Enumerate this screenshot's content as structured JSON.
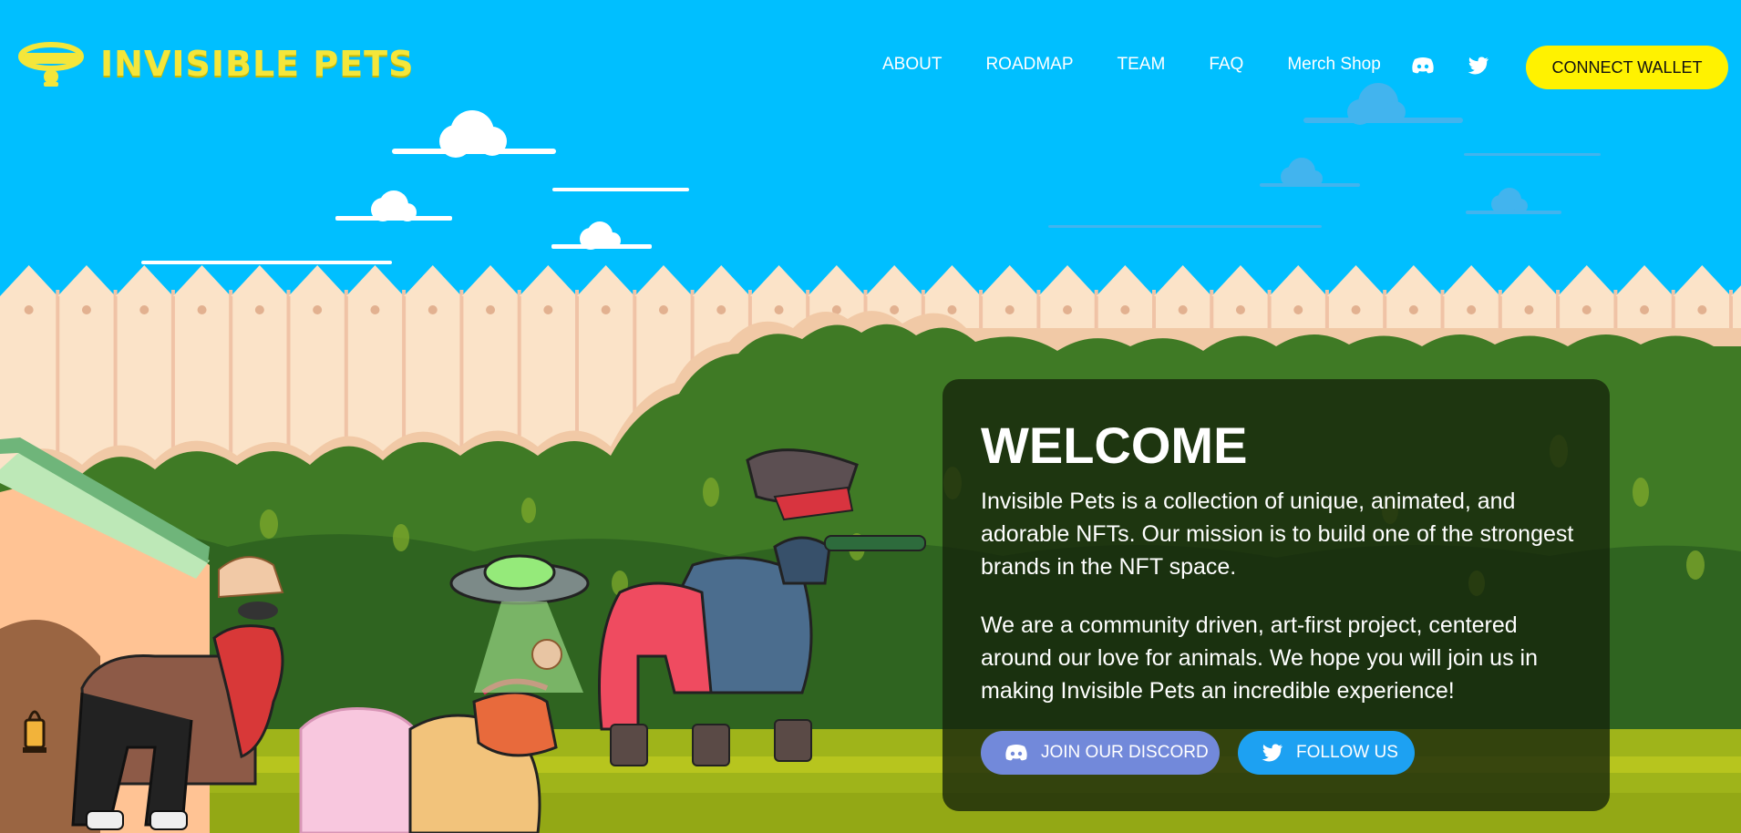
{
  "header": {
    "logo_text": "INVISIBLE PETS",
    "logo_badge_text": "INVISIBLE PETS",
    "nav": [
      "ABOUT",
      "ROADMAP",
      "TEAM",
      "FAQ",
      "Merch Shop"
    ],
    "connect_wallet": "CONNECT WALLET"
  },
  "welcome": {
    "title": "WELCOME",
    "paragraph1": "Invisible Pets is a collection of unique, animated, and adorable NFTs. Our mission is to build one of the strongest brands in the NFT space.",
    "paragraph2": "We are a community driven, art-first project, centered around our love for animals. We hope you will join us in making Invisible Pets an incredible experience!",
    "discord_button": "JOIN OUR DISCORD",
    "follow_button": "FOLLOW US"
  },
  "colors": {
    "sky": "#00bfff",
    "logo_yellow": "#f4e63a",
    "wallet_button": "#fff200",
    "discord_button": "#7289da",
    "twitter_button": "#1da1f2",
    "fence": "#fbe3c8",
    "bushes": "#3f7a25",
    "grass": "#a4b51a"
  },
  "icons": [
    "discord-icon",
    "twitter-icon",
    "logo-collar-icon"
  ]
}
